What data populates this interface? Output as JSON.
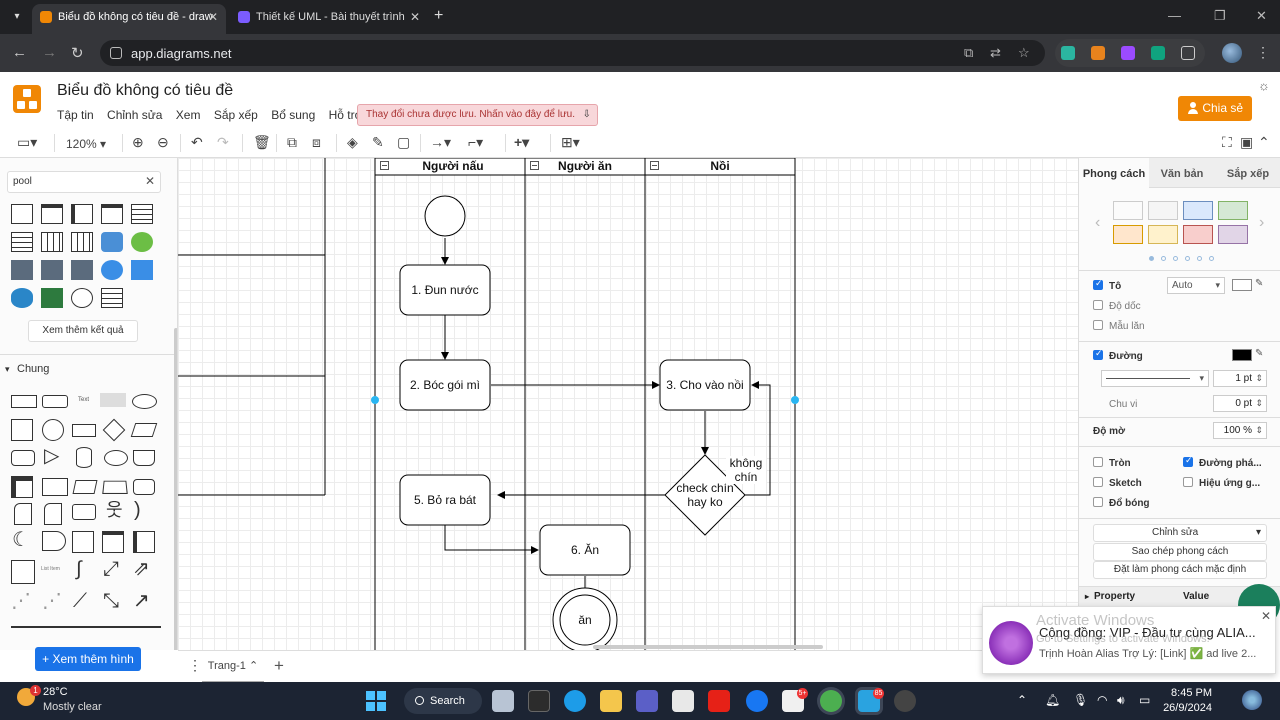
{
  "browser": {
    "tabs": [
      {
        "title": "Biểu đồ không có tiêu đề - draw",
        "active": true
      },
      {
        "title": "Thiết kế UML - Bài thuyết trình",
        "active": false
      }
    ],
    "url": "app.diagrams.net"
  },
  "app": {
    "title": "Biểu đồ không có tiêu đề",
    "menu": [
      "Tập tin",
      "Chỉnh sửa",
      "Xem",
      "Sắp xếp",
      "Bổ sung",
      "Hỗ trợ"
    ],
    "unsaved_notice": "Thay đổi chưa được lưu. Nhấn vào đây để lưu.",
    "share_label": "Chia sẻ"
  },
  "toolbar": {
    "zoom": "120%"
  },
  "sidebar": {
    "search_value": "pool",
    "more_results": "Xem thêm kết quả",
    "section_general": "Chung",
    "add_shapes": "+ Xem thêm hình"
  },
  "diagram": {
    "lanes": [
      "Người nấu",
      "Người ăn",
      "Nồi"
    ],
    "nodes": {
      "n1": "1. Đun nước",
      "n2": "2. Bóc gói mì",
      "n3": "3. Cho vào nồi",
      "n5": "5. Bỏ ra bát",
      "n6": "6. Ăn",
      "decision": "check chín hay ko",
      "end": "ăn"
    },
    "edge_labels": {
      "not_cooked": "không chín"
    }
  },
  "pagebar": {
    "page_name": "Trang-1"
  },
  "format_panel": {
    "tabs": [
      "Phong cách",
      "Văn bản",
      "Sắp xếp"
    ],
    "fill_label": "Tô",
    "fill_value": "Auto",
    "gradient_label": "Độ dốc",
    "pattern_label": "Mẫu lăn",
    "line_label": "Đường",
    "line_width": "1 pt",
    "perimeter_label": "Chu vi",
    "perimeter_value": "0 pt",
    "opacity_label": "Độ mờ",
    "opacity_value": "100 %",
    "options": {
      "rounded": "Tròn",
      "sketch": "Sketch",
      "shadow": "Đổ bóng",
      "orthogonal": "Đường phá...",
      "glass": "Hiệu ứng g..."
    },
    "edit_select": "Chỉnh sửa",
    "copy_style": "Sao chép phong cách",
    "set_default": "Đặt làm phong cách mặc định",
    "property_col": "Property",
    "value_col": "Value",
    "swatches": [
      "#ffffff",
      "#f5f5f5",
      "#dae8fc",
      "#d5e8d4",
      "#ffe6cc",
      "#fff2cc",
      "#f8cecc",
      "#e1d5e7"
    ]
  },
  "notification": {
    "watermark": "Activate Windows",
    "watermark_sub": "Go to Settings to activate Windows.",
    "title": "Cộng đồng: VIP - Đầu tư cùng ALIA...",
    "body": "Trịnh Hoàn Alias Trợ Lý: [Link] ✅ ad live 2..."
  },
  "taskbar": {
    "temperature": "28°C",
    "condition": "Mostly clear",
    "weather_badge": "1",
    "search_label": "Search",
    "time": "8:45 PM",
    "date": "26/9/2024"
  }
}
